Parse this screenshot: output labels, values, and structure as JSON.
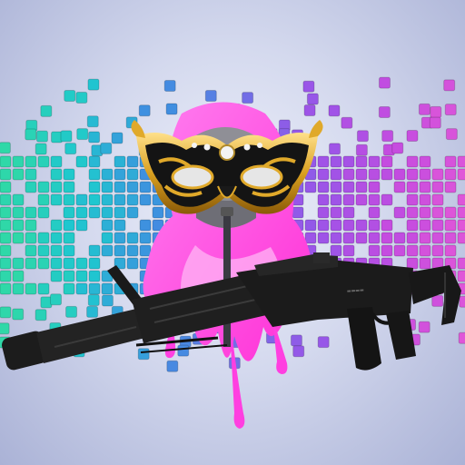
{
  "scene": {
    "title": "",
    "colors": {
      "background_center": "#eef1fa",
      "background_edge": "#aab2d6",
      "cube_gradient": [
        "#2fd8a8",
        "#1fc7cf",
        "#3f8fe0",
        "#6f6fe6",
        "#9a55e8",
        "#c44ce0",
        "#e057d8"
      ],
      "hood_pink": "#ff3fe0",
      "hood_light": "#ffb6f4",
      "mask_gold": "#d9a020",
      "mask_black": "#141414",
      "rifle_black": "#1c1c1c"
    },
    "layers": [
      {
        "name": "voxel-cube-wall",
        "icon": "cube-grid-icon"
      },
      {
        "name": "pink-hooded-figure",
        "icon": "hood-icon"
      },
      {
        "name": "masquerade-mask",
        "icon": "mask-icon"
      },
      {
        "name": "assault-rifle",
        "icon": "rifle-icon"
      }
    ]
  }
}
